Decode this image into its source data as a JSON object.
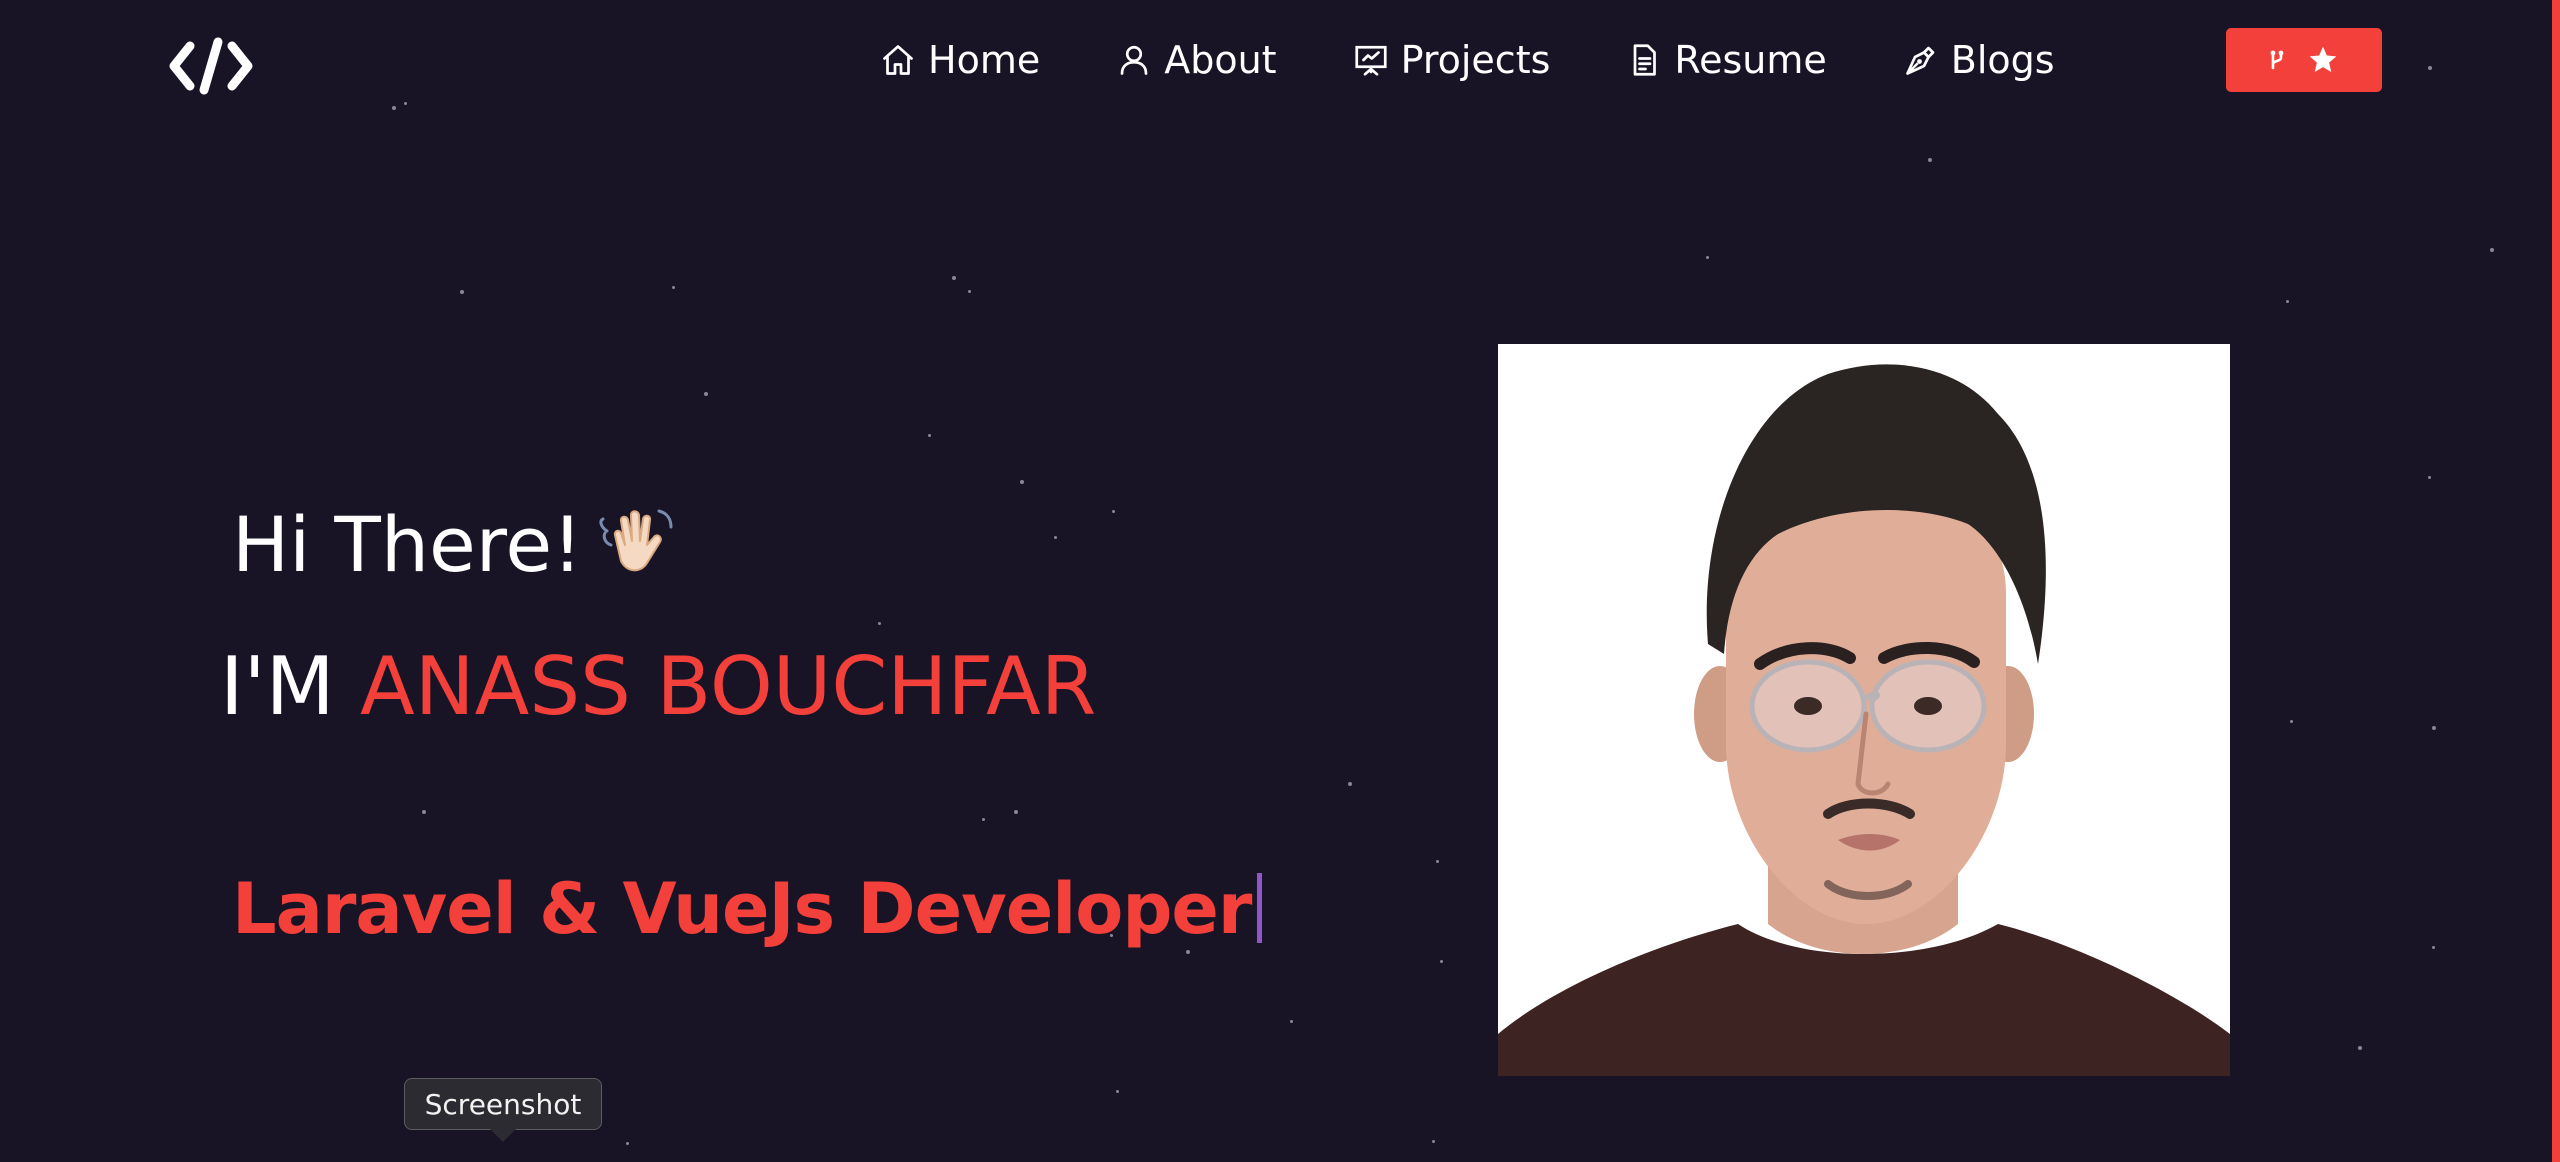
{
  "colors": {
    "background": "#181426",
    "accent": "#f4403b",
    "text": "#ffffff",
    "caret": "#8f57c9"
  },
  "logo": {
    "icon": "code-brackets-icon"
  },
  "nav": {
    "items": [
      {
        "label": "Home",
        "icon": "home-icon"
      },
      {
        "label": "About",
        "icon": "user-icon"
      },
      {
        "label": "Projects",
        "icon": "presentation-icon"
      },
      {
        "label": "Resume",
        "icon": "document-icon"
      },
      {
        "label": "Blogs",
        "icon": "pen-icon"
      }
    ],
    "github_button": {
      "icons": [
        "git-fork-icon",
        "star-icon"
      ]
    }
  },
  "hero": {
    "greeting": "Hi There!",
    "greeting_emoji": "waving-hand-icon",
    "intro_prefix": "I'M",
    "name": "ANASS BOUCHFAR",
    "role": "Laravel & VueJs Developer"
  },
  "profile_photo": {
    "alt": "profile photo"
  },
  "tooltip": {
    "text": "Screenshot"
  }
}
